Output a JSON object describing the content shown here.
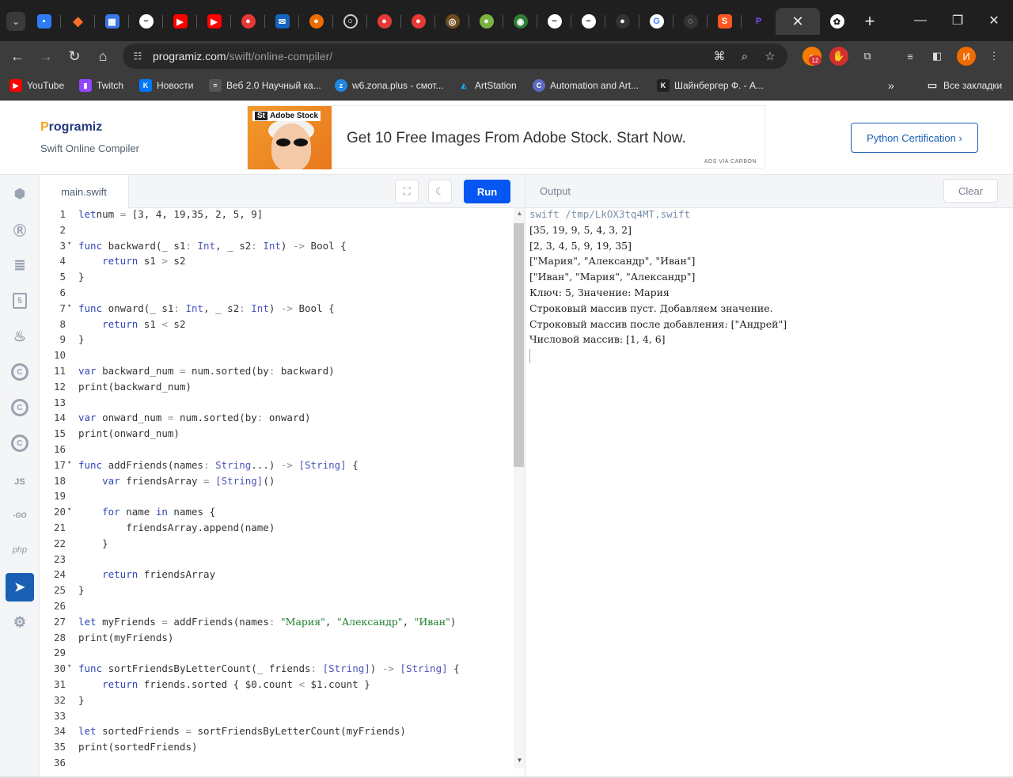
{
  "browser": {
    "tab_count_badge": "12",
    "new_tab": "+",
    "url_host": "programiz.com",
    "url_path": "/swift/online-compiler/",
    "profile_initial": "И",
    "bookmarks": [
      {
        "label": "YouTube",
        "icon": "youtube-icon",
        "color": "#ff0000"
      },
      {
        "label": "Twitch",
        "icon": "twitch-icon",
        "color": "#9146ff"
      },
      {
        "label": "Новости",
        "icon": "vk-icon",
        "color": "#0077ff"
      },
      {
        "label": "Веб 2.0 Научный ка...",
        "icon": "calc-icon",
        "color": "#555555"
      },
      {
        "label": "w6.zona.plus - смот...",
        "icon": "zona-icon",
        "color": "#1e88e5"
      },
      {
        "label": "ArtStation",
        "icon": "artstation-icon",
        "color": "#13aff0"
      },
      {
        "label": "Automation and Art...",
        "icon": "circle-c-icon",
        "color": "#5c6bc0"
      },
      {
        "label": "Шайнбергер Ф. - А...",
        "icon": "vk-icon",
        "color": "#222222"
      }
    ],
    "all_bookmarks": "Все закладки",
    "more_bookmarks": "»"
  },
  "header": {
    "logo_first": "P",
    "logo_rest": "rogramiz",
    "subtitle": "Swift Online Compiler",
    "ad_badge_st": "St",
    "ad_badge_text": "Adobe Stock",
    "ad_text": "Get 10 Free Images From Adobe Stock. Start Now.",
    "ad_via": "ADS VIA CARBON",
    "cert_button": "Python Certification ›"
  },
  "sidebar": {
    "languages": [
      {
        "name": "python",
        "glyph": "🐍"
      },
      {
        "name": "r",
        "glyph": "R"
      },
      {
        "name": "sql",
        "glyph": "≡"
      },
      {
        "name": "html",
        "glyph": "5"
      },
      {
        "name": "java",
        "glyph": "♨"
      },
      {
        "name": "c",
        "glyph": "C"
      },
      {
        "name": "cpp",
        "glyph": "C"
      },
      {
        "name": "csharp",
        "glyph": "C"
      },
      {
        "name": "javascript",
        "glyph": "JS"
      },
      {
        "name": "go",
        "glyph": "GO"
      },
      {
        "name": "php",
        "glyph": "php"
      },
      {
        "name": "swift",
        "glyph": "➤"
      },
      {
        "name": "rust",
        "glyph": "R"
      }
    ]
  },
  "editor": {
    "filename": "main.swift",
    "run_label": "Run"
  },
  "code_lines": [
    {
      "n": "1",
      "fold": "",
      "tokens": [
        [
          "kw",
          "let"
        ],
        [
          "",
          "num "
        ],
        [
          "op",
          "="
        ],
        [
          "",
          " [3, 4, 19,35, 2, 5, 9]"
        ]
      ]
    },
    {
      "n": "2",
      "fold": "",
      "tokens": []
    },
    {
      "n": "3",
      "fold": "▾",
      "tokens": [
        [
          "kw",
          "func"
        ],
        [
          "",
          " backward(_ s1"
        ],
        [
          "op",
          ":"
        ],
        [
          "ty",
          " Int"
        ],
        [
          "",
          ", _ s2"
        ],
        [
          "op",
          ":"
        ],
        [
          "ty",
          " Int"
        ],
        [
          "",
          ") "
        ],
        [
          "op",
          "->"
        ],
        [
          "",
          " Bool {"
        ]
      ]
    },
    {
      "n": "4",
      "fold": "",
      "tokens": [
        [
          "",
          "    "
        ],
        [
          "kw",
          "return"
        ],
        [
          "",
          " s1 "
        ],
        [
          "op",
          ">"
        ],
        [
          "",
          " s2"
        ]
      ]
    },
    {
      "n": "5",
      "fold": "",
      "tokens": [
        [
          "",
          "}"
        ]
      ]
    },
    {
      "n": "6",
      "fold": "",
      "tokens": []
    },
    {
      "n": "7",
      "fold": "▾",
      "tokens": [
        [
          "kw",
          "func"
        ],
        [
          "",
          " onward(_ s1"
        ],
        [
          "op",
          ":"
        ],
        [
          "ty",
          " Int"
        ],
        [
          "",
          ", _ s2"
        ],
        [
          "op",
          ":"
        ],
        [
          "ty",
          " Int"
        ],
        [
          "",
          ") "
        ],
        [
          "op",
          "->"
        ],
        [
          "",
          " Bool {"
        ]
      ]
    },
    {
      "n": "8",
      "fold": "",
      "tokens": [
        [
          "",
          "    "
        ],
        [
          "kw",
          "return"
        ],
        [
          "",
          " s1 "
        ],
        [
          "op",
          "<"
        ],
        [
          "",
          " s2"
        ]
      ]
    },
    {
      "n": "9",
      "fold": "",
      "tokens": [
        [
          "",
          "}"
        ]
      ]
    },
    {
      "n": "10",
      "fold": "",
      "tokens": []
    },
    {
      "n": "11",
      "fold": "",
      "tokens": [
        [
          "kw",
          "var"
        ],
        [
          "",
          " backward_num "
        ],
        [
          "op",
          "="
        ],
        [
          "",
          " num.sorted(by"
        ],
        [
          "op",
          ":"
        ],
        [
          "",
          " backward)"
        ]
      ]
    },
    {
      "n": "12",
      "fold": "",
      "tokens": [
        [
          "",
          "print(backward_num)"
        ]
      ]
    },
    {
      "n": "13",
      "fold": "",
      "tokens": []
    },
    {
      "n": "14",
      "fold": "",
      "tokens": [
        [
          "kw",
          "var"
        ],
        [
          "",
          " onward_num "
        ],
        [
          "op",
          "="
        ],
        [
          "",
          " num.sorted(by"
        ],
        [
          "op",
          ":"
        ],
        [
          "",
          " onward)"
        ]
      ]
    },
    {
      "n": "15",
      "fold": "",
      "tokens": [
        [
          "",
          "print(onward_num)"
        ]
      ]
    },
    {
      "n": "16",
      "fold": "",
      "tokens": []
    },
    {
      "n": "17",
      "fold": "▾",
      "tokens": [
        [
          "kw",
          "func"
        ],
        [
          "",
          " addFriends(names"
        ],
        [
          "op",
          ":"
        ],
        [
          "ty",
          " String"
        ],
        [
          "",
          "...) "
        ],
        [
          "op",
          "->"
        ],
        [
          "ty",
          " [String]"
        ],
        [
          "",
          " {"
        ]
      ]
    },
    {
      "n": "18",
      "fold": "",
      "tokens": [
        [
          "",
          "    "
        ],
        [
          "kw",
          "var"
        ],
        [
          "",
          " friendsArray "
        ],
        [
          "op",
          "="
        ],
        [
          "ty",
          " [String]"
        ],
        [
          "",
          "()"
        ]
      ]
    },
    {
      "n": "19",
      "fold": "",
      "tokens": []
    },
    {
      "n": "20",
      "fold": "▾",
      "tokens": [
        [
          "",
          "    "
        ],
        [
          "kw",
          "for"
        ],
        [
          "",
          " name "
        ],
        [
          "kw",
          "in"
        ],
        [
          "",
          " names {"
        ]
      ]
    },
    {
      "n": "21",
      "fold": "",
      "tokens": [
        [
          "",
          "        friendsArray.append(name)"
        ]
      ]
    },
    {
      "n": "22",
      "fold": "",
      "tokens": [
        [
          "",
          "    }"
        ]
      ]
    },
    {
      "n": "23",
      "fold": "",
      "tokens": []
    },
    {
      "n": "24",
      "fold": "",
      "tokens": [
        [
          "",
          "    "
        ],
        [
          "kw",
          "return"
        ],
        [
          "",
          " friendsArray"
        ]
      ]
    },
    {
      "n": "25",
      "fold": "",
      "tokens": [
        [
          "",
          "}"
        ]
      ]
    },
    {
      "n": "26",
      "fold": "",
      "tokens": []
    },
    {
      "n": "27",
      "fold": "",
      "tokens": [
        [
          "kw",
          "let"
        ],
        [
          "",
          " myFriends "
        ],
        [
          "op",
          "="
        ],
        [
          "",
          " addFriends(names"
        ],
        [
          "op",
          ":"
        ],
        [
          "",
          " "
        ],
        [
          "st",
          "\"Мария\""
        ],
        [
          "",
          ", "
        ],
        [
          "st",
          "\"Александр\""
        ],
        [
          "",
          ", "
        ],
        [
          "st",
          "\"Иван\""
        ],
        [
          "",
          ")"
        ]
      ]
    },
    {
      "n": "28",
      "fold": "",
      "tokens": [
        [
          "",
          "print(myFriends)"
        ]
      ]
    },
    {
      "n": "29",
      "fold": "",
      "tokens": []
    },
    {
      "n": "30",
      "fold": "▾",
      "tokens": [
        [
          "kw",
          "func"
        ],
        [
          "",
          " sortFriendsByLetterCount(_ friends"
        ],
        [
          "op",
          ":"
        ],
        [
          "ty",
          " [String]"
        ],
        [
          "",
          ") "
        ],
        [
          "op",
          "->"
        ],
        [
          "ty",
          " [String]"
        ],
        [
          "",
          " {"
        ]
      ]
    },
    {
      "n": "31",
      "fold": "",
      "tokens": [
        [
          "",
          "    "
        ],
        [
          "kw",
          "return"
        ],
        [
          "",
          " friends.sorted { $0.count "
        ],
        [
          "op",
          "<"
        ],
        [
          "",
          " $1.count }"
        ]
      ]
    },
    {
      "n": "32",
      "fold": "",
      "tokens": [
        [
          "",
          "}"
        ]
      ]
    },
    {
      "n": "33",
      "fold": "",
      "tokens": []
    },
    {
      "n": "34",
      "fold": "",
      "tokens": [
        [
          "kw",
          "let"
        ],
        [
          "",
          " sortedFriends "
        ],
        [
          "op",
          "="
        ],
        [
          "",
          " sortFriendsByLetterCount(myFriends)"
        ]
      ]
    },
    {
      "n": "35",
      "fold": "",
      "tokens": [
        [
          "",
          "print(sortedFriends)"
        ]
      ]
    },
    {
      "n": "36",
      "fold": "",
      "tokens": []
    }
  ],
  "output": {
    "title": "Output",
    "clear_label": "Clear",
    "command": "swift /tmp/LkOX3tq4MT.swift",
    "lines": [
      "[35, 19, 9, 5, 4, 3, 2]",
      "[2, 3, 4, 5, 9, 19, 35]",
      "[\"Мария\", \"Александр\", \"Иван\"]",
      "[\"Иван\", \"Мария\", \"Александр\"]",
      "Ключ: 5, Значение: Мария",
      "Строковый массив пуст. Добавляем значение.",
      "Строковый массив после добавления: [\"Андрей\"]",
      "Числовой массив: [1, 4, 6]"
    ]
  }
}
